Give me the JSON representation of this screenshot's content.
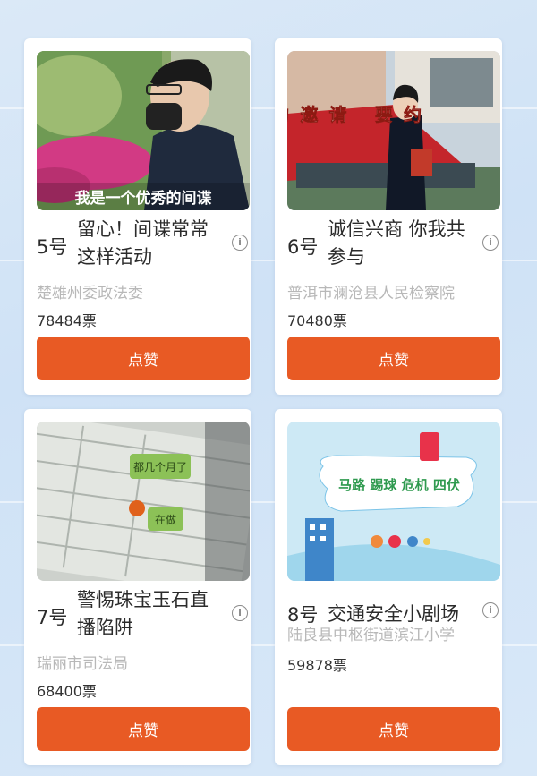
{
  "cards": [
    {
      "number": "5号",
      "title": "留心！间谍常常这样活动",
      "org": "楚雄州委政法委",
      "votes": "78484票",
      "button": "点赞",
      "caption": "我是一个优秀的间谍"
    },
    {
      "number": "6号",
      "title": "诚信兴商 你我共参与",
      "org": "普洱市澜沧县人民检察院",
      "votes": "70480票",
      "button": "点赞",
      "overlay_text": "要约邀请   要约"
    },
    {
      "number": "7号",
      "title": "警惕珠宝玉石直播陷阱",
      "org": "瑞丽市司法局",
      "votes": "68400票",
      "button": "点赞",
      "bubble_1": "都几个月了",
      "bubble_2": "在做"
    },
    {
      "number": "8号",
      "title": "交通安全小剧场",
      "org": "陆良县中枢街道滨江小学",
      "votes": "59878票",
      "button": "点赞",
      "overlay_text": "马路 踢球 危机 四伏"
    }
  ],
  "colors": {
    "accent": "#e85a24",
    "background": "#d4e6f7"
  },
  "icons": [
    "info-icon"
  ]
}
